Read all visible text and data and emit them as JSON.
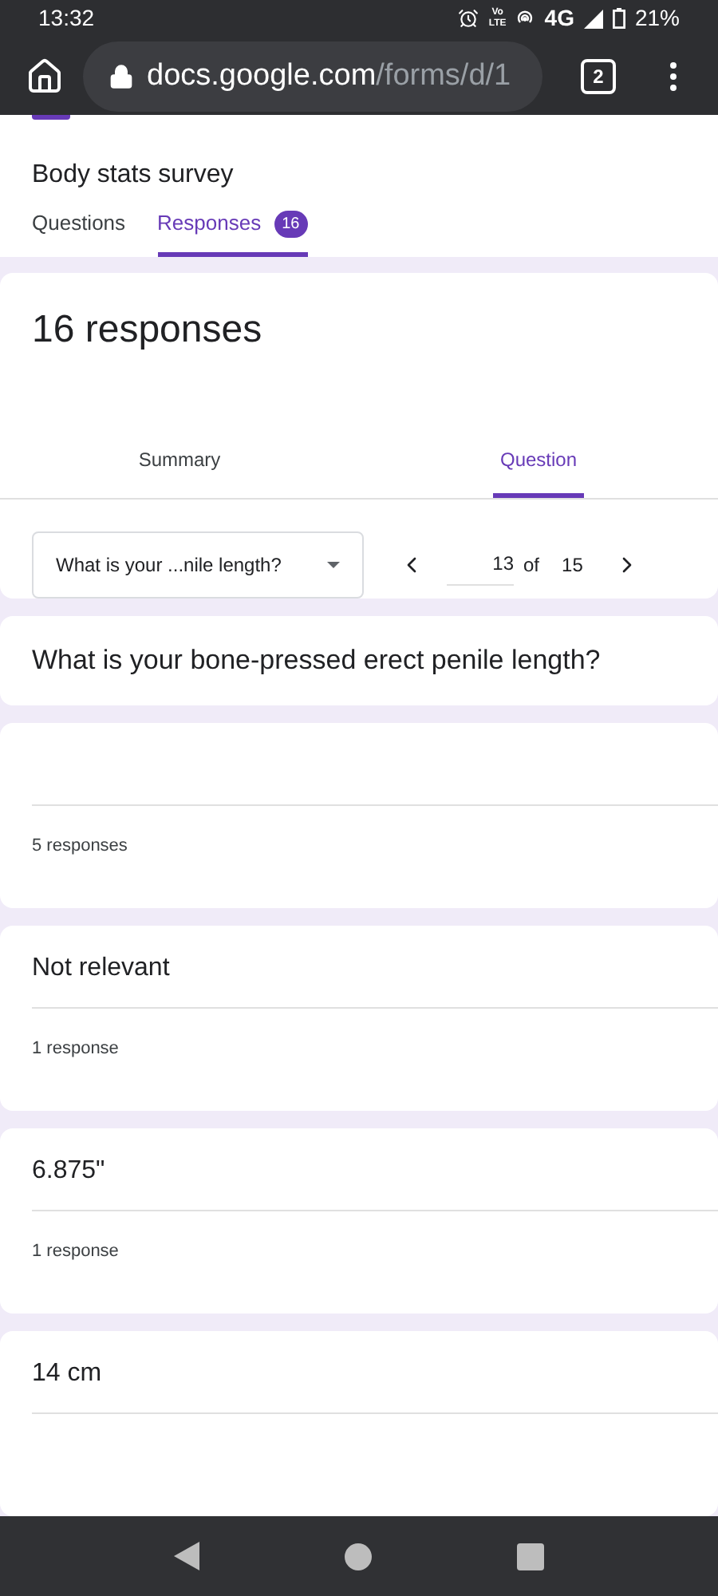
{
  "status_bar": {
    "time": "13:32",
    "volte_top": "Vo",
    "volte_bottom": "LTE",
    "network": "4G",
    "battery": "21%"
  },
  "browser": {
    "url_host": "docs.google.com",
    "url_path": "/forms/d/1",
    "tab_count": "2"
  },
  "form": {
    "title": "Body stats survey",
    "tabs": [
      {
        "label": "Questions",
        "selected": false
      },
      {
        "label": "Responses",
        "selected": true,
        "badge": "16"
      }
    ]
  },
  "responses_card": {
    "heading": "16 responses",
    "view_tabs": [
      {
        "label": "Summary",
        "selected": false
      },
      {
        "label": "Question",
        "selected": true
      }
    ],
    "question_select": {
      "value": "What is your ...nile length?"
    },
    "pager": {
      "current": "13",
      "of": "of",
      "total": "15"
    }
  },
  "question": "What is your bone-pressed erect penile length?",
  "answers": [
    {
      "count": "5 responses"
    },
    {
      "answer": "Not relevant",
      "count": "1 response"
    },
    {
      "answer": "6.875\"",
      "count": "1 response"
    },
    {
      "answer": "14 cm"
    }
  ]
}
